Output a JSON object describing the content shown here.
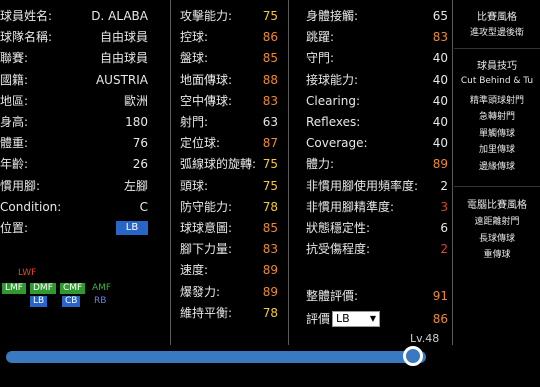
{
  "profile": {
    "rows": [
      {
        "label": "球員姓名:",
        "value": "D. ALABA"
      },
      {
        "label": "球隊名稱:",
        "value": "自由球員"
      },
      {
        "label": "聯賽:",
        "value": "自由球員"
      },
      {
        "label": "國籍:",
        "value": "AUSTRIA"
      },
      {
        "label": "地區:",
        "value": "歐洲"
      },
      {
        "label": "身高:",
        "value": "180"
      },
      {
        "label": "體重:",
        "value": "76"
      },
      {
        "label": "年齡:",
        "value": "26"
      },
      {
        "label": "慣用腳:",
        "value": "左腳"
      },
      {
        "label": "Condition:",
        "value": "C"
      },
      {
        "label": "位置:",
        "value": "LB"
      }
    ]
  },
  "positions": {
    "line1": [
      {
        "label": "LWF",
        "color": "#e0442a"
      }
    ],
    "line2": [
      {
        "label": "LMF",
        "style": "green"
      },
      {
        "label": "DMF",
        "style": "green"
      },
      {
        "label": "CMF",
        "style": "green"
      },
      {
        "label": "AMF",
        "color": "#3bb33b"
      }
    ],
    "line3": [
      {
        "label": "LB",
        "style": "blue"
      },
      {
        "label": "CB",
        "style": "blue"
      },
      {
        "label": "RB",
        "color": "#6f7fe0"
      }
    ]
  },
  "attack_stats": [
    {
      "label": "攻擊能力:",
      "value": "75",
      "color": "y"
    },
    {
      "label": "控球:",
      "value": "86",
      "color": "o"
    },
    {
      "label": "盤球:",
      "value": "85",
      "color": "o"
    },
    {
      "label": "地面傳球:",
      "value": "88",
      "color": "o"
    },
    {
      "label": "空中傳球:",
      "value": "83",
      "color": "o"
    },
    {
      "label": "射門:",
      "value": "63",
      "color": "w"
    },
    {
      "label": "定位球:",
      "value": "87",
      "color": "o"
    },
    {
      "label": "弧線球的旋轉:",
      "value": "75",
      "color": "y"
    },
    {
      "label": "頭球:",
      "value": "75",
      "color": "y"
    },
    {
      "label": "防守能力:",
      "value": "78",
      "color": "y"
    },
    {
      "label": "球球意圖:",
      "value": "85",
      "color": "o"
    },
    {
      "label": "腳下力量:",
      "value": "83",
      "color": "o"
    },
    {
      "label": "速度:",
      "value": "89",
      "color": "o"
    },
    {
      "label": "爆發力:",
      "value": "89",
      "color": "o"
    },
    {
      "label": "維持平衡:",
      "value": "78",
      "color": "y"
    }
  ],
  "physical_stats": [
    {
      "label": "身體接觸:",
      "value": "65",
      "color": "w"
    },
    {
      "label": "跳躍:",
      "value": "83",
      "color": "o"
    },
    {
      "label": "守門:",
      "value": "40",
      "color": "w"
    },
    {
      "label": "接球能力:",
      "value": "40",
      "color": "w"
    },
    {
      "label": "Clearing:",
      "value": "40",
      "color": "w"
    },
    {
      "label": "Reflexes:",
      "value": "40",
      "color": "w"
    },
    {
      "label": "Coverage:",
      "value": "40",
      "color": "w"
    },
    {
      "label": "體力:",
      "value": "89",
      "color": "o"
    },
    {
      "label": "非慣用腳使用頻率度:",
      "value": "2",
      "color": "w"
    },
    {
      "label": "非慣用腳精準度:",
      "value": "3",
      "color": "r"
    },
    {
      "label": "狀態穩定性:",
      "value": "6",
      "color": "w"
    },
    {
      "label": "抗受傷程度:",
      "value": "2",
      "color": "r"
    }
  ],
  "summary": {
    "rating_label": "整體評價:",
    "rating_value": "91",
    "eval_label": "評價",
    "eval_select": "LB",
    "eval_value": "86"
  },
  "level": {
    "label": "Lv.48",
    "fraction": 0.97
  },
  "sidebar": {
    "style_title": "比賽風格",
    "style_value": "進攻型邊後衛",
    "skills_title": "球員技巧",
    "skills": [
      "Cut Behind & Tu",
      "精準頭球射門",
      "急轉射門",
      "單觸傳球",
      "加里傳球",
      "邊緣傳球"
    ],
    "ai_title": "電腦比賽風格",
    "ai_items": [
      "遠距離射門",
      "長球傳球",
      "重傳球"
    ]
  }
}
